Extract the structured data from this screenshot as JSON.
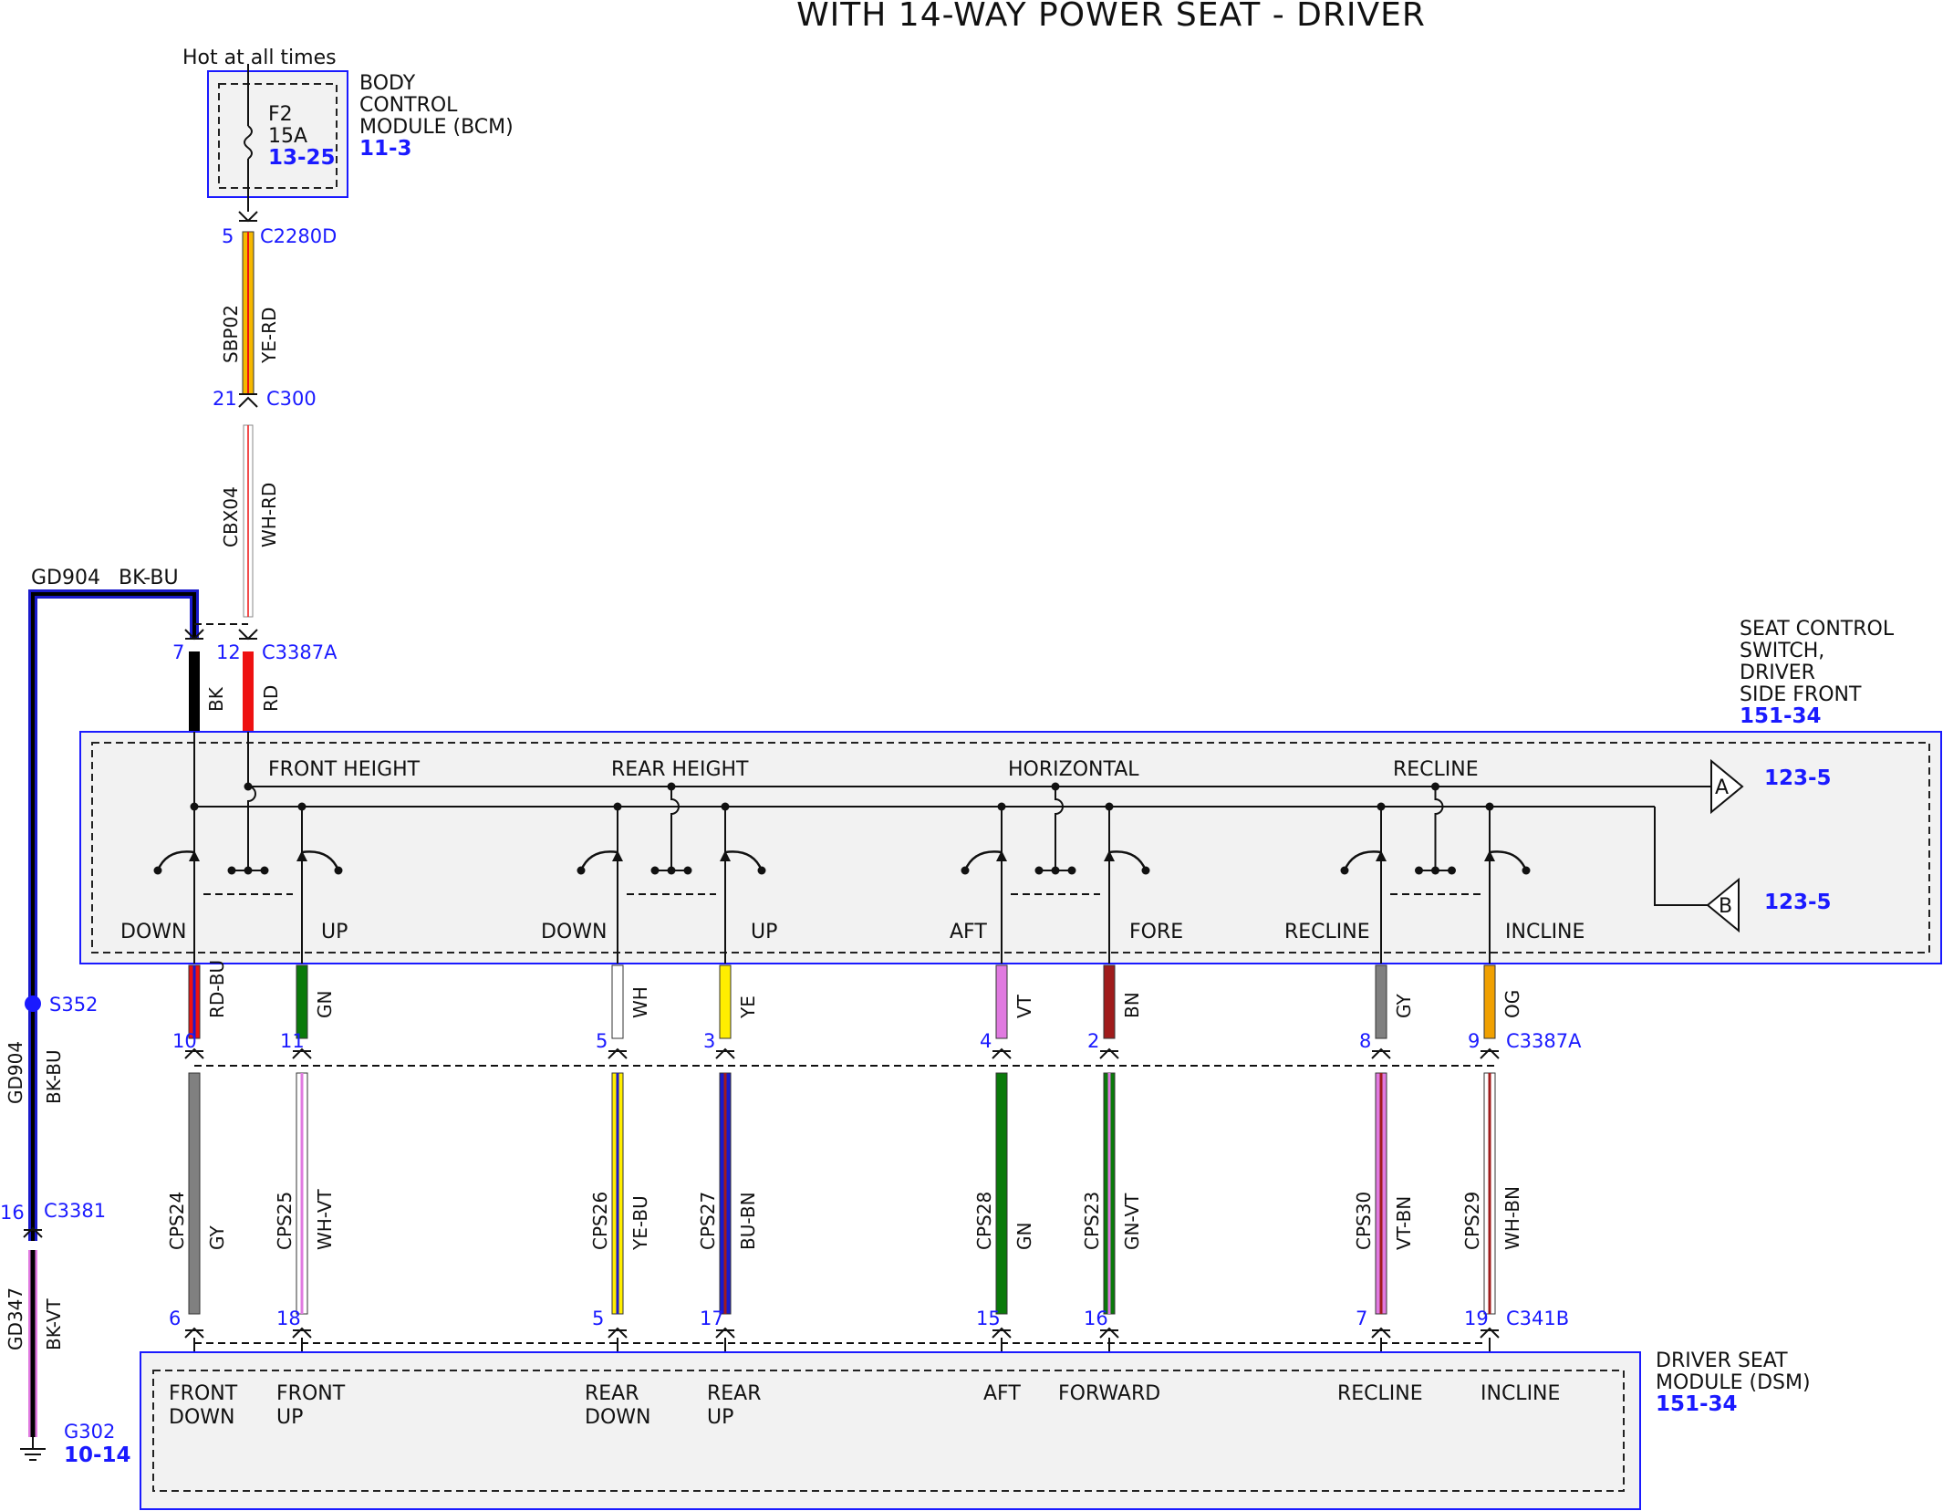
{
  "title": "WITH 14-WAY POWER SEAT - DRIVER",
  "bcm": {
    "hot_label": "Hot at all times",
    "fuse": "F2",
    "fuse_rating": "15A",
    "fuse_ref": "13-25",
    "name_lines": [
      "BODY",
      "CONTROL",
      "MODULE (BCM)"
    ],
    "ref": "11-3"
  },
  "power_feed": {
    "pin1": "5",
    "conn1": "C2280D",
    "circuit1": "SBP02",
    "color1": "YE-RD",
    "pin2": "21",
    "conn2": "C300",
    "circuit2": "CBX04",
    "color2": "WH-RD"
  },
  "ground_feed": {
    "circuit": "GD904",
    "color": "BK-BU",
    "splice": "S352",
    "pin": "16",
    "conn": "C3381",
    "circuit2": "GD347",
    "color2": "BK-VT",
    "ground": "G302",
    "ground_ref": "10-14"
  },
  "switch_input": {
    "pin_bk": "7",
    "pin_rd": "12",
    "conn": "C3387A",
    "color_bk": "BK",
    "color_rd": "RD"
  },
  "switch": {
    "name_lines": [
      "SEAT CONTROL",
      "SWITCH,",
      "DRIVER",
      "SIDE FRONT"
    ],
    "ref": "151-34",
    "sections": [
      "FRONT HEIGHT",
      "REAR HEIGHT",
      "HORIZONTAL",
      "RECLINE"
    ],
    "out_a_label": "A",
    "out_a_ref": "123-5",
    "out_b_label": "B",
    "out_b_ref": "123-5",
    "positions": [
      "DOWN",
      "UP",
      "DOWN",
      "UP",
      "AFT",
      "FORE",
      "RECLINE",
      "INCLINE"
    ]
  },
  "switch_conn": "C3387A",
  "dsm_conn": "C341B",
  "wires": [
    {
      "sw_color": "RD-BU",
      "sw_pin": "10",
      "circuit": "CPS24",
      "color": "GY",
      "dsm_pin": "6",
      "dsm_label": [
        "FRONT",
        "DOWN"
      ]
    },
    {
      "sw_color": "GN",
      "sw_pin": "11",
      "circuit": "CPS25",
      "color": "WH-VT",
      "dsm_pin": "18",
      "dsm_label": [
        "FRONT",
        "UP"
      ]
    },
    {
      "sw_color": "WH",
      "sw_pin": "5",
      "circuit": "CPS26",
      "color": "YE-BU",
      "dsm_pin": "5",
      "dsm_label": [
        "REAR",
        "DOWN"
      ]
    },
    {
      "sw_color": "YE",
      "sw_pin": "3",
      "circuit": "CPS27",
      "color": "BU-BN",
      "dsm_pin": "17",
      "dsm_label": [
        "REAR",
        "UP"
      ]
    },
    {
      "sw_color": "VT",
      "sw_pin": "4",
      "circuit": "CPS28",
      "color": "GN",
      "dsm_pin": "15",
      "dsm_label": [
        "AFT",
        ""
      ]
    },
    {
      "sw_color": "BN",
      "sw_pin": "2",
      "circuit": "CPS23",
      "color": "GN-VT",
      "dsm_pin": "16",
      "dsm_label": [
        "FORWARD",
        ""
      ]
    },
    {
      "sw_color": "GY",
      "sw_pin": "8",
      "circuit": "CPS30",
      "color": "VT-BN",
      "dsm_pin": "7",
      "dsm_label": [
        "RECLINE",
        ""
      ]
    },
    {
      "sw_color": "OG",
      "sw_pin": "9",
      "circuit": "CPS29",
      "color": "WH-BN",
      "dsm_pin": "19",
      "dsm_label": [
        "INCLINE",
        ""
      ]
    }
  ],
  "dsm": {
    "name_lines": [
      "DRIVER SEAT",
      "MODULE (DSM)"
    ],
    "ref": "151-34"
  },
  "wire_colors": {
    "BK": "#000000",
    "RD": "#ee1111",
    "GN": "#0a7a0a",
    "WH": "#ffffff",
    "YE": "#ffee00",
    "VT": "#e07ae0",
    "BN": "#a01c1c",
    "GY": "#808080",
    "OG": "#f0a000",
    "BU": "#1a1acc",
    "power_ye": "#f5b800"
  },
  "colors": {
    "box_border": "#1a1aff",
    "box_fill": "#f2f2f2",
    "ref_blue": "#1a1aff"
  }
}
